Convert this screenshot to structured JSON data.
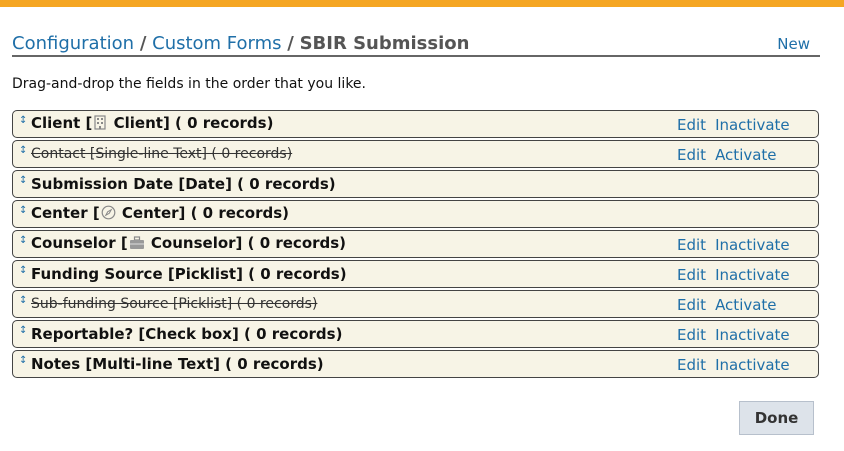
{
  "breadcrumb": {
    "items": [
      "Configuration",
      "Custom Forms"
    ],
    "separator": "/",
    "current": "SBIR Submission"
  },
  "header": {
    "new_label": "New"
  },
  "instructions": "Drag-and-drop the fields in the order that you like.",
  "fields": [
    {
      "prefix": "Client [",
      "icon": "building-icon",
      "suffix": " Client] ( 0 records)",
      "status": "active",
      "edit": "Edit",
      "toggle": "Inactivate"
    },
    {
      "prefix": "Contact [Single-line Text] ( 0 records)",
      "icon": "",
      "suffix": "",
      "status": "inactive",
      "edit": "Edit",
      "toggle": "Activate"
    },
    {
      "prefix": "Submission Date [Date] ( 0 records)",
      "icon": "",
      "suffix": "",
      "status": "active",
      "edit": "",
      "toggle": ""
    },
    {
      "prefix": "Center [",
      "icon": "compass-icon",
      "suffix": " Center] ( 0 records)",
      "status": "active",
      "edit": "",
      "toggle": ""
    },
    {
      "prefix": "Counselor [",
      "icon": "briefcase-icon",
      "suffix": " Counselor] ( 0 records)",
      "status": "active",
      "edit": "Edit",
      "toggle": "Inactivate"
    },
    {
      "prefix": "Funding Source [Picklist] ( 0 records)",
      "icon": "",
      "suffix": "",
      "status": "active",
      "edit": "Edit",
      "toggle": "Inactivate"
    },
    {
      "prefix": "Sub-funding Source [Picklist] ( 0 records)",
      "icon": "",
      "suffix": "",
      "status": "inactive",
      "edit": "Edit",
      "toggle": "Activate"
    },
    {
      "prefix": "Reportable? [Check box] ( 0 records)",
      "icon": "",
      "suffix": "",
      "status": "active",
      "edit": "Edit",
      "toggle": "Inactivate"
    },
    {
      "prefix": "Notes [Multi-line Text] ( 0 records)",
      "icon": "",
      "suffix": "",
      "status": "active",
      "edit": "Edit",
      "toggle": "Inactivate"
    }
  ],
  "done_label": "Done",
  "colors": {
    "accent_bar": "#f5a623",
    "link": "#1f6fa8",
    "row_bg": "#f7f4e6"
  }
}
